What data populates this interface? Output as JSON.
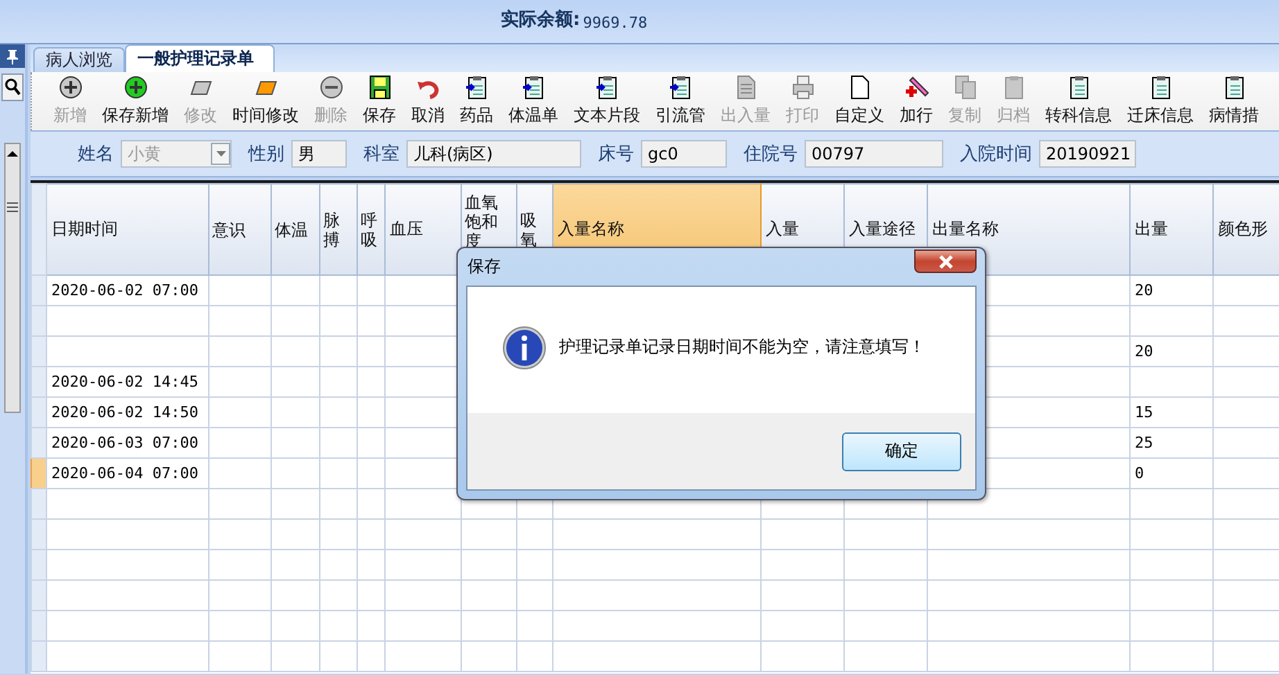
{
  "balance": {
    "label": "实际余额:",
    "value": "9969.78"
  },
  "tabs": [
    {
      "label": "病人浏览",
      "selected": false
    },
    {
      "label": "一般护理记录单",
      "selected": true
    }
  ],
  "toolbar": [
    {
      "label": "新增",
      "disabled": true
    },
    {
      "label": "保存新增",
      "disabled": false
    },
    {
      "label": "修改",
      "disabled": true
    },
    {
      "label": "时间修改",
      "disabled": false
    },
    {
      "label": "删除",
      "disabled": true
    },
    {
      "label": "保存",
      "disabled": false
    },
    {
      "label": "取消",
      "disabled": false
    },
    {
      "label": "药品",
      "disabled": false
    },
    {
      "label": "体温单",
      "disabled": false
    },
    {
      "label": "文本片段",
      "disabled": false
    },
    {
      "label": "引流管",
      "disabled": false
    },
    {
      "label": "出入量",
      "disabled": true
    },
    {
      "label": "打印",
      "disabled": true
    },
    {
      "label": "自定义",
      "disabled": false
    },
    {
      "label": "加行",
      "disabled": false
    },
    {
      "label": "复制",
      "disabled": true
    },
    {
      "label": "归档",
      "disabled": true
    },
    {
      "label": "转科信息",
      "disabled": false
    },
    {
      "label": "迁床信息",
      "disabled": false
    },
    {
      "label": "病情措",
      "disabled": false
    }
  ],
  "patient": [
    {
      "label": "姓名",
      "value": "小黄",
      "kind": "combo",
      "disabled": true
    },
    {
      "label": "性别",
      "value": "男",
      "kind": "text",
      "disabled": false
    },
    {
      "label": "科室",
      "value": "儿科(病区)",
      "kind": "text",
      "disabled": false
    },
    {
      "label": "床号",
      "value": "gc0",
      "kind": "text",
      "disabled": false
    },
    {
      "label": "住院号",
      "value": "00797",
      "kind": "text",
      "disabled": false
    },
    {
      "label": "入院时间",
      "value": "20190921",
      "kind": "text",
      "disabled": false
    }
  ],
  "table": {
    "columns": [
      {
        "label": "日期时间",
        "selected": false
      },
      {
        "label": "意识",
        "selected": false
      },
      {
        "label": "体温",
        "selected": false
      },
      {
        "label": "脉搏",
        "selected": false
      },
      {
        "label": "呼吸",
        "selected": false
      },
      {
        "label": "血压",
        "selected": false
      },
      {
        "label": "血氧饱和度",
        "selected": false
      },
      {
        "label": "吸氧",
        "selected": false
      },
      {
        "label": "入量名称",
        "selected": true
      },
      {
        "label": "入量",
        "selected": false
      },
      {
        "label": "入量途径",
        "selected": false
      },
      {
        "label": "出量名称",
        "selected": false
      },
      {
        "label": "出量",
        "selected": false
      },
      {
        "label": "颜色形",
        "selected": false
      }
    ],
    "rows": [
      {
        "current": false,
        "date_time": "2020-06-02 07:00",
        "output": "20"
      },
      {
        "current": false
      },
      {
        "current": false,
        "output": "20"
      },
      {
        "current": false,
        "date_time": "2020-06-02 14:45"
      },
      {
        "current": false,
        "date_time": "2020-06-02 14:50",
        "output": "15"
      },
      {
        "current": false,
        "date_time": "2020-06-03 07:00",
        "output": "25"
      },
      {
        "current": true,
        "date_time": "2020-06-04 07:00",
        "output": "0"
      }
    ]
  },
  "dialog": {
    "title": "保存",
    "message": "护理记录单记录日期时间不能为空，请注意填写！",
    "button": "确定"
  }
}
